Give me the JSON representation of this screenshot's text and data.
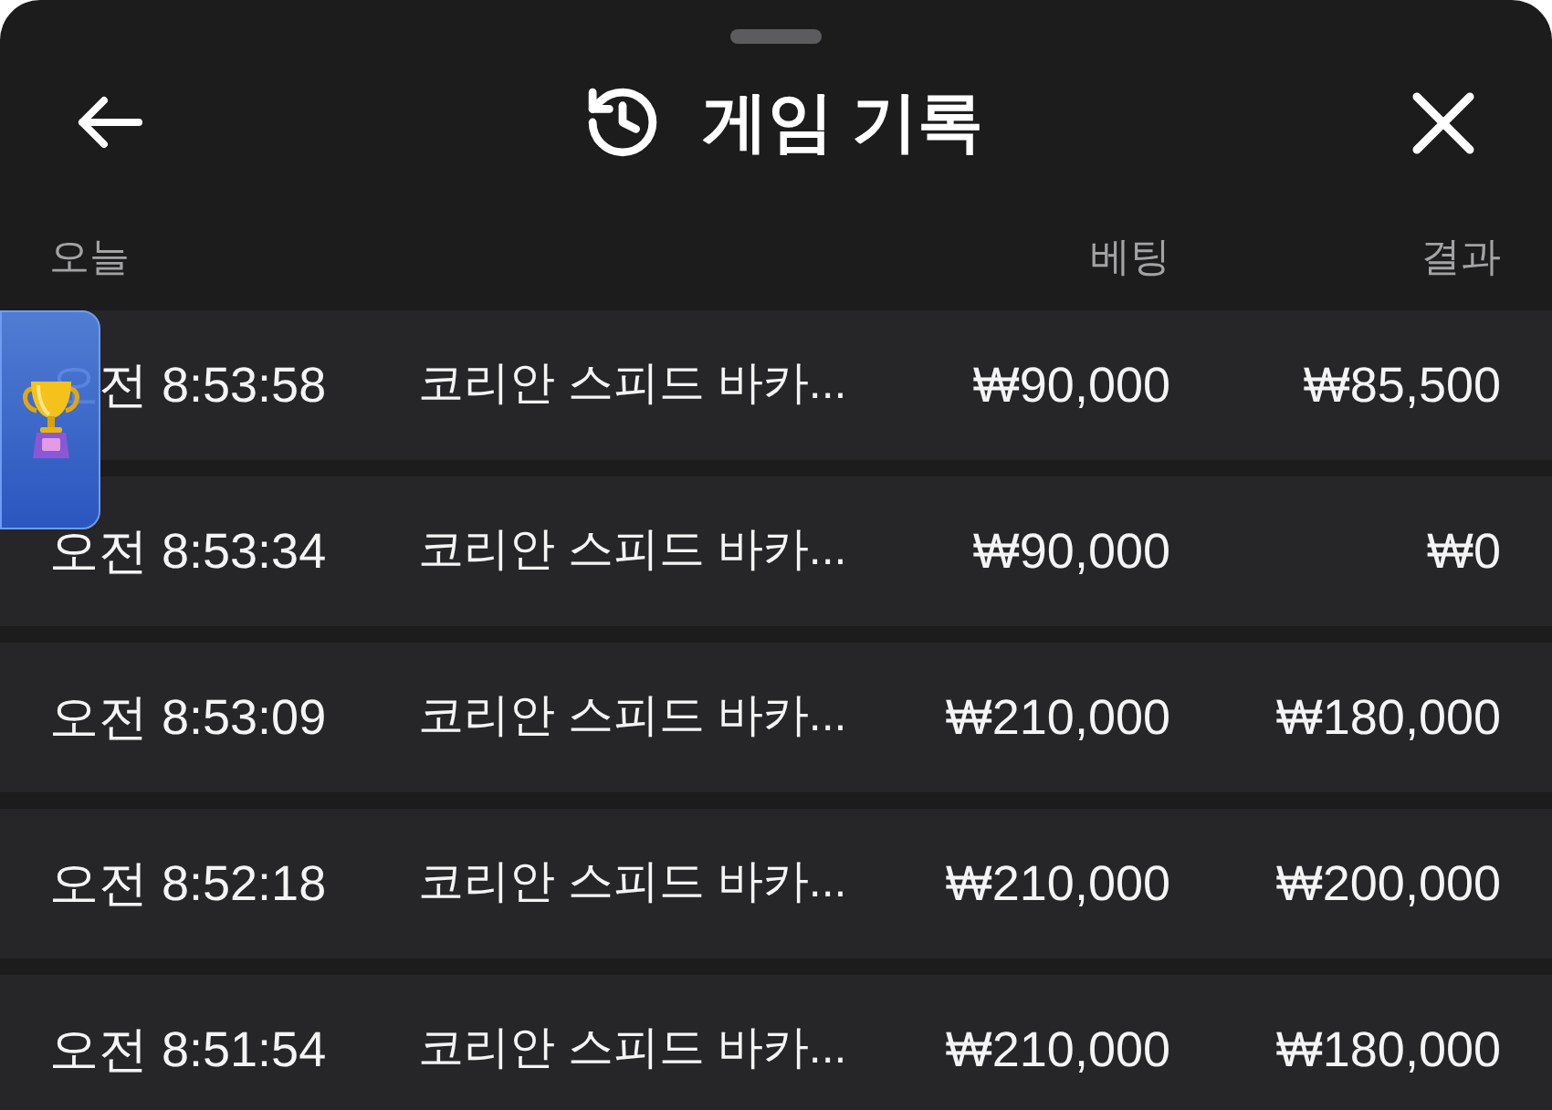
{
  "header": {
    "title": "게임 기록"
  },
  "table": {
    "date_heading": "오늘",
    "bet_heading": "베팅",
    "result_heading": "결과",
    "rows": [
      {
        "time": "오전 8:53:58",
        "game": "코리안 스피드 바카...",
        "bet": "₩90,000",
        "result": "₩85,500"
      },
      {
        "time": "오전 8:53:34",
        "game": "코리안 스피드 바카...",
        "bet": "₩90,000",
        "result": "₩0"
      },
      {
        "time": "오전 8:53:09",
        "game": "코리안 스피드 바카...",
        "bet": "₩210,000",
        "result": "₩180,000"
      },
      {
        "time": "오전 8:52:18",
        "game": "코리안 스피드 바카...",
        "bet": "₩210,000",
        "result": "₩200,000"
      },
      {
        "time": "오전 8:51:54",
        "game": "코리안 스피드 바카...",
        "bet": "₩210,000",
        "result": "₩180,000"
      }
    ]
  }
}
